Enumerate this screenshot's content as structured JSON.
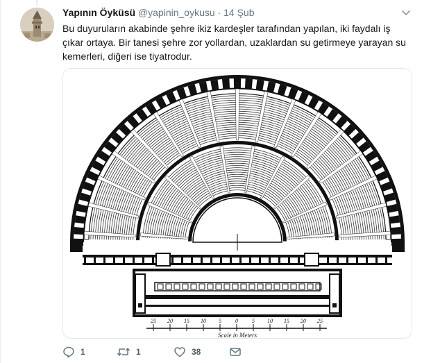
{
  "tweet": {
    "author_name": "Yapının Öyküsü",
    "handle": "@yapinin_oykusu",
    "separator": "·",
    "date": "14 Şub",
    "text": "Bu duyuruların akabinde şehre ikiz kardeşler tarafından yapılan, iki faydalı iş çıkar ortaya. Bir tanesi şehre zor yollardan, uzaklardan su getirmeye yarayan su kemerleri, diğeri ise tiyatrodur."
  },
  "image": {
    "scale_labels": [
      "25",
      "20",
      "15",
      "10",
      "5",
      "0",
      "5",
      "10",
      "15",
      "20",
      "25"
    ],
    "scale_caption": "Scale in Meters"
  },
  "actions": {
    "reply_count": "1",
    "retweet_count": "1",
    "like_count": "38"
  },
  "icons": {
    "chevron": "chevron-down-icon",
    "reply": "reply-icon",
    "retweet": "retweet-icon",
    "like": "heart-icon",
    "dm": "envelope-icon"
  },
  "colors": {
    "secondary_text": "#657786",
    "border": "#e1e8ed"
  }
}
